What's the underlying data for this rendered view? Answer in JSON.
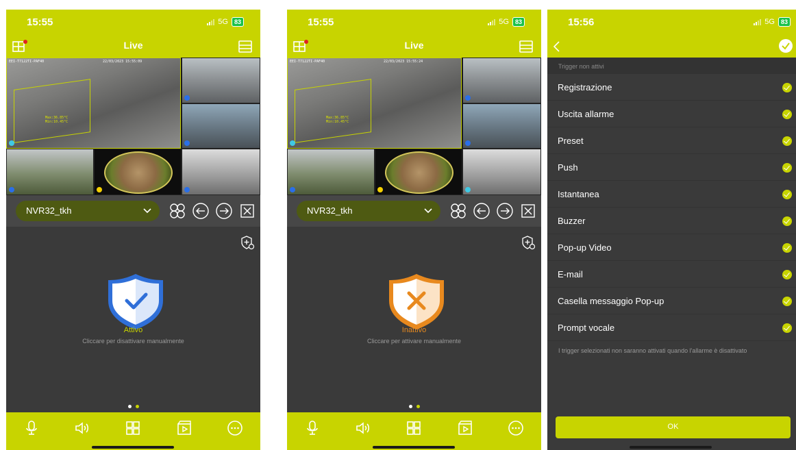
{
  "screens": {
    "live_active": {
      "time": "15:55",
      "network": "5G",
      "battery": "83",
      "title": "Live",
      "device": "NVR32_tkh",
      "osd_left": "EEI-T7122TI-PAF40",
      "osd_date": "22/03/2023 15:55:09",
      "roi_text_1": "Max:36.85°C",
      "roi_text_2": "Min:10.45°C",
      "status": "Attivo",
      "status_sub": "Cliccare per disattivare manualmente",
      "status_color": "#c8d400",
      "shield_color": "#4a7fd6"
    },
    "live_inactive": {
      "time": "15:55",
      "network": "5G",
      "battery": "83",
      "title": "Live",
      "device": "NVR32_tkh",
      "osd_left": "EEI-T7122TI-PAF40",
      "osd_date": "22/03/2023 15:55:24",
      "roi_text_1": "Max:36.85°C",
      "roi_text_2": "Min:10.45°C",
      "status": "Inattivo",
      "status_sub": "Cliccare per attivare manualmente",
      "status_color": "#e8891e",
      "shield_color": "#e8891e"
    },
    "triggers": {
      "time": "15:56",
      "network": "5G",
      "battery": "83",
      "section_header": "Trigger non attivi",
      "items": [
        "Registrazione",
        "Uscita allarme",
        "Preset",
        "Push",
        "Istantanea",
        "Buzzer",
        "Pop-up Video",
        "E-mail",
        "Casella messaggio Pop-up",
        "Prompt vocale"
      ],
      "footnote": "I trigger selezionati non saranno attivati quando l'allarme è disattivato",
      "ok": "OK"
    }
  },
  "icons": {
    "statusbar": "signal-icon",
    "nav_left": "split-view-icon",
    "nav_right": "device-list-icon",
    "controls": [
      "layout-icon",
      "previous-icon",
      "next-icon",
      "close-all-icon"
    ],
    "bottom": [
      "microphone-icon",
      "speaker-icon",
      "grid-icon",
      "playback-icon",
      "more-icon"
    ]
  },
  "colors": {
    "accent": "#c8d400",
    "background": "#3a3a3a",
    "device_pill": "#4e5a12"
  }
}
